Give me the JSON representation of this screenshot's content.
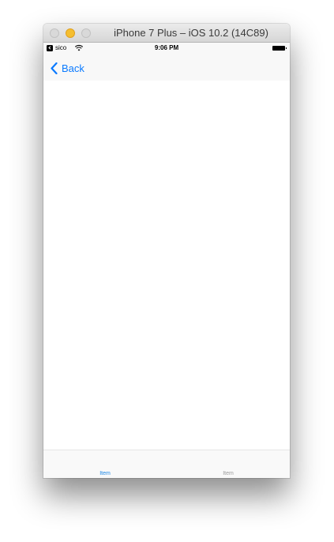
{
  "window": {
    "title": "iPhone 7 Plus – iOS 10.2 (14C89)"
  },
  "status_bar": {
    "back_app_icon": "back-to-app-icon",
    "carrier": "sico",
    "wifi_icon": "wifi-icon",
    "time": "9:06 PM",
    "battery_icon": "battery-icon"
  },
  "nav_bar": {
    "back_icon": "chevron-left-icon",
    "back_label": "Back"
  },
  "tab_bar": {
    "tabs": [
      {
        "label": "Item",
        "selected": true
      },
      {
        "label": "Item",
        "selected": false
      }
    ]
  },
  "colors": {
    "tint": "#0a7aff",
    "tab_active": "#1e88e5",
    "tab_inactive": "#9b9b9b",
    "minimize_button": "#f5be2f"
  }
}
